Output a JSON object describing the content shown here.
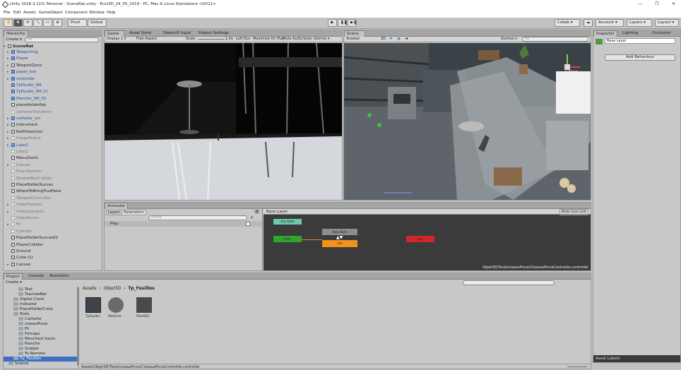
{
  "window": {
    "title": "Unity 2018.3.11f1 Personal - SceneRat.unity - Envi3D_24_05_2019 - PC, Mac & Linux Standalone <DX11>",
    "minimize": "—",
    "restore": "❐",
    "close": "✕"
  },
  "menu": [
    "File",
    "Edit",
    "Assets",
    "GameObject",
    "Component",
    "Window",
    "Help"
  ],
  "toolbar": {
    "pivot": "Pivot",
    "global": "Global",
    "collab": "Collab ▾",
    "account": "Account ▾",
    "layers": "Layers ▾",
    "layout": "Layout ▾",
    "icons": {
      "hand": "hand-icon",
      "move": "move-icon",
      "rotate": "rotate-icon",
      "scale": "scale-icon",
      "rect": "rect-icon"
    }
  },
  "hierarchy": {
    "tab": "Hierarchy",
    "create": "Create ▾",
    "search_placeholder": "All",
    "scene": "SceneRat",
    "items": [
      {
        "label": "Teleporting",
        "color": "blue",
        "arrow": "▸",
        "indent": 1
      },
      {
        "label": "Player",
        "color": "blue",
        "arrow": "▸",
        "indent": 1
      },
      {
        "label": "TeleportZone",
        "color": "normal",
        "arrow": "▸",
        "indent": 1
      },
      {
        "label": "paper_low",
        "color": "blue",
        "arrow": "▸",
        "indent": 1
      },
      {
        "label": "controller",
        "color": "blue",
        "arrow": "▸",
        "indent": 1
      },
      {
        "label": "TpFeuille_SM",
        "color": "blue",
        "arrow": "",
        "indent": 1
      },
      {
        "label": "TpFeuille_SM (1)",
        "color": "blue",
        "arrow": "",
        "indent": 1
      },
      {
        "label": "Planche_SM_02",
        "color": "blue",
        "arrow": "",
        "indent": 1
      },
      {
        "label": "placeHolderRat",
        "color": "normal",
        "arrow": "",
        "indent": 1
      },
      {
        "label": "catheterTransform",
        "color": "dim",
        "arrow": "",
        "indent": 1
      },
      {
        "label": "catheter_sm",
        "color": "blue",
        "arrow": "▸",
        "indent": 1
      },
      {
        "label": "Instrument",
        "color": "normal",
        "arrow": "▸",
        "indent": 1
      },
      {
        "label": "RatDissection",
        "color": "normal",
        "arrow": "▸",
        "indent": 1
      },
      {
        "label": "ImageStatus",
        "color": "dim",
        "arrow": "▸",
        "indent": 1
      },
      {
        "label": "Labo1",
        "color": "blue",
        "arrow": "▸",
        "indent": 1
      },
      {
        "label": "Labo2",
        "color": "dim",
        "arrow": "",
        "indent": 1
      },
      {
        "label": "MenuZoom",
        "color": "normal",
        "arrow": "",
        "indent": 1
      },
      {
        "label": "Canvas",
        "color": "dim",
        "arrow": "▸",
        "indent": 1
      },
      {
        "label": "EventSystem",
        "color": "dim",
        "arrow": "",
        "indent": 1
      },
      {
        "label": "DisableBoxCollider",
        "color": "dim",
        "arrow": "",
        "indent": 1
      },
      {
        "label": "PlaceHolderSucces",
        "color": "normal",
        "arrow": "",
        "indent": 1
      },
      {
        "label": "WhereToBringTrueFalse",
        "color": "normal",
        "arrow": "",
        "indent": 1
      },
      {
        "label": "TeleportController",
        "color": "dim",
        "arrow": "",
        "indent": 1
      },
      {
        "label": "VideoTraches",
        "color": "dim",
        "arrow": "▸",
        "indent": 1
      },
      {
        "label": "VideoJugulaire",
        "color": "dim",
        "arrow": "▸",
        "indent": 1
      },
      {
        "label": "VideoBonus",
        "color": "dim",
        "arrow": "",
        "indent": 1
      },
      {
        "label": "Fil",
        "color": "dim",
        "arrow": "▸",
        "indent": 1
      },
      {
        "label": "Cylinder",
        "color": "dim",
        "arrow": "",
        "indent": 1
      },
      {
        "label": "PlaceHolderSucces02",
        "color": "normal",
        "arrow": "",
        "indent": 1
      },
      {
        "label": "PlayerCollider",
        "color": "normal",
        "arrow": "",
        "indent": 1
      },
      {
        "label": "Ground",
        "color": "normal",
        "arrow": "",
        "indent": 1
      },
      {
        "label": "Cube (1)",
        "color": "normal",
        "arrow": "",
        "indent": 1
      },
      {
        "label": "Canvas",
        "color": "normal",
        "arrow": "▸",
        "indent": 1
      }
    ]
  },
  "game": {
    "tabs": [
      "Game",
      "Asset Store",
      "Steam® Input",
      "Project Settings"
    ],
    "display": "Display 1 ▾",
    "aspect": "Free Aspect",
    "scale_label": "Scale",
    "scale_value": "1.0x",
    "eye": "Left Eye",
    "options": [
      "Maximize On Play",
      "Mute Audio",
      "Stats",
      "Gizmos ▾"
    ]
  },
  "scene": {
    "tab": "Scene",
    "shading": "Shaded",
    "mode2d": "2D",
    "gizmos": "Gizmos ▾",
    "search_placeholder": "All",
    "persp": "< Persp"
  },
  "inspector": {
    "tabs": [
      "Inspector",
      "Lighting",
      "Occlusion"
    ],
    "layer_name": "Base Layer",
    "add_behaviour": "Add Behaviour",
    "asset_labels": "Asset Labels"
  },
  "animator": {
    "tab": "Animator",
    "subtabs": [
      "Layers",
      "Parameters"
    ],
    "search_placeholder": "Name",
    "param": "Play",
    "layer": "Base Layer",
    "autolive": "Auto Live Link",
    "states": {
      "entry": "Any State",
      "green": "Entry",
      "orange": "Lire",
      "gray": "New State",
      "red": "Exit"
    },
    "path": "Objet3D/Tools/ciseauPince/CiseauxPinceController.controller"
  },
  "project": {
    "tabs": [
      "Project",
      "Console",
      "Animation"
    ],
    "create": "Create ▾",
    "breadcrumb": [
      "Assets",
      "Objet3D",
      "Tp_Feuilles"
    ],
    "tree": [
      {
        "label": "Text",
        "indent": 3
      },
      {
        "label": "TracheeRat",
        "indent": 3
      },
      {
        "label": "Digital Clock",
        "indent": 2
      },
      {
        "label": "Indicator",
        "indent": 2
      },
      {
        "label": "PlaceHolderCroix",
        "indent": 2
      },
      {
        "label": "Tools",
        "indent": 2
      },
      {
        "label": "Catheter",
        "indent": 3
      },
      {
        "label": "ciseauPince",
        "indent": 3
      },
      {
        "label": "Fil",
        "indent": 3
      },
      {
        "label": "Forceps",
        "indent": 3
      },
      {
        "label": "Moucheur basis",
        "indent": 3
      },
      {
        "label": "Planche",
        "indent": 3
      },
      {
        "label": "Scalpel",
        "indent": 3
      },
      {
        "label": "To Remote",
        "indent": 3
      },
      {
        "label": "Tp_Feuilles",
        "indent": 2
      },
      {
        "label": "Scenes",
        "indent": 1
      }
    ],
    "assets": [
      {
        "label": "TpFeuille..."
      },
      {
        "label": "Material..."
      },
      {
        "label": "Plan004"
      }
    ],
    "status_path": "Assets/Objet3D/Tools/ciseauPince/CiseauxPinceController.controller"
  }
}
